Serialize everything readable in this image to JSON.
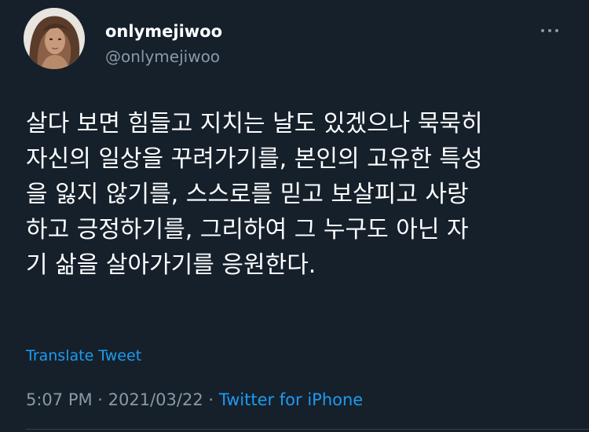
{
  "author": {
    "display_name": "onlymejiwoo",
    "handle": "@onlymejiwoo",
    "avatar_icon": "profile-photo"
  },
  "more_icon": "more-horizontal-icon",
  "tweet": {
    "lines": [
      "살다 보면 힘들고 지치는 날도 있겠으나 묵묵히",
      "자신의 일상을 꾸려가기를, 본인의 고유한 특성",
      "을 잃지 않기를, 스스로를 믿고 보살피고 사랑",
      "하고 긍정하기를, 그리하여 그 누구도 아닌 자",
      "기 삶을 살아가기를 응원한다."
    ]
  },
  "translate_label": "Translate Tweet",
  "meta": {
    "time": "5:07 PM",
    "separator": " · ",
    "date": "2021/03/22",
    "source": "Twitter for iPhone"
  },
  "colors": {
    "background": "#15202b",
    "text": "#ffffff",
    "muted": "#8b98a5",
    "link": "#1d9bf0"
  }
}
